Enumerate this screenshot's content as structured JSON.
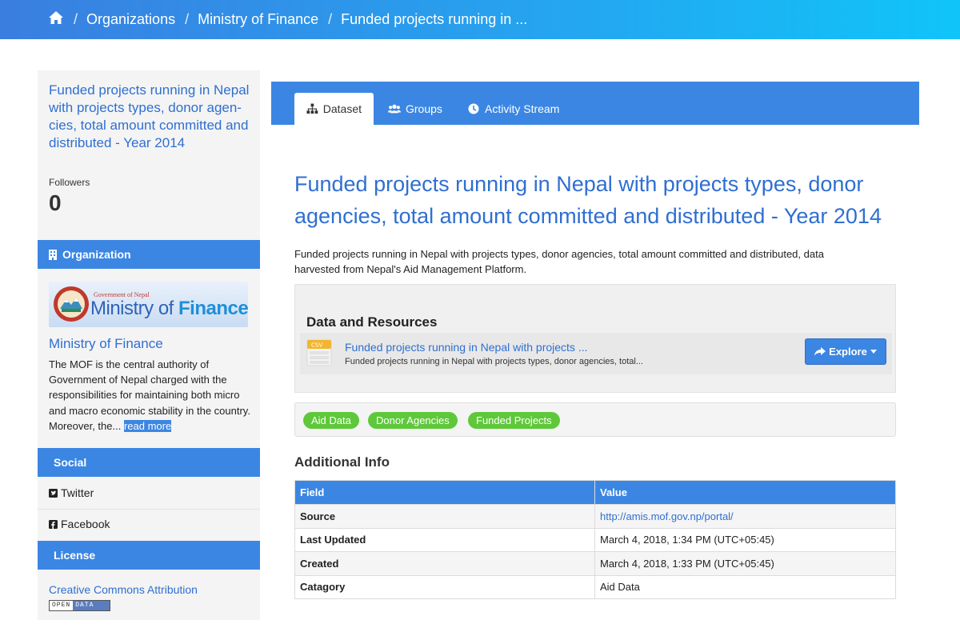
{
  "breadcrumb": {
    "home_icon": "home-icon",
    "separator": "/",
    "items": [
      "Organizations",
      "Ministry of Finance",
      "Funded projects running in ..."
    ]
  },
  "sidebar": {
    "dataset_title": "Funded projects running in Nepal with projects types, donor agen-cies, total amount committed and distributed - Year 2014",
    "followers_label": "Followers",
    "followers_count": "0",
    "organization_heading": "Organization",
    "org_logo": {
      "gov_text": "Government of Nepal",
      "ministry_text": "Ministry of ",
      "finance_text": "Finance"
    },
    "org_name": "Ministry of Finance",
    "org_description": "The MOF is the central authority of Government of Nepal charged with the responsibilities for maintaining both micro and macro economic stability in the country. Moreover, the...",
    "read_more": "read more",
    "social_heading": "Social",
    "social_items": [
      {
        "label": "Twitter",
        "icon": "twitter-icon"
      },
      {
        "label": "Facebook",
        "icon": "facebook-icon"
      }
    ],
    "license_heading": "License",
    "license_name": "Creative Commons Attribution",
    "open_data_badge": {
      "left": "OPEN",
      "right": "DATA"
    }
  },
  "tabs": [
    {
      "label": "Dataset",
      "icon": "sitemap-icon",
      "active": true
    },
    {
      "label": "Groups",
      "icon": "users-icon",
      "active": false
    },
    {
      "label": "Activity Stream",
      "icon": "clock-icon",
      "active": false
    }
  ],
  "main": {
    "title": "Funded projects running in Nepal with projects types, donor agencies, total amount committed and distributed - Year 2014",
    "description": "Funded projects running in Nepal with projects types, donor agencies, total amount committed and distributed, data harvested from Nepal's Aid Management Platform.",
    "resources_heading": "Data and Resources",
    "resource": {
      "format": "CSV",
      "name": "Funded projects running in Nepal with projects ...",
      "description": "Funded projects running in Nepal with projects types, donor agencies, total...",
      "explore_label": "Explore"
    },
    "tags": [
      "Aid Data",
      "Donor Agencies",
      "Funded Projects"
    ],
    "additional_info_heading": "Additional Info",
    "table": {
      "headers": [
        "Field",
        "Value"
      ],
      "rows": [
        {
          "field": "Source",
          "value": "http://amis.mof.gov.np/portal/"
        },
        {
          "field": "Last Updated",
          "value": "March 4, 2018, 1:34 PM (UTC+05:45)"
        },
        {
          "field": "Created",
          "value": "March 4, 2018, 1:33 PM (UTC+05:45)"
        },
        {
          "field": "Catagory",
          "value": "Aid Data"
        }
      ]
    }
  },
  "colors": {
    "primary": "#3b86e3",
    "link": "#2f6fd1",
    "tag": "#5ec83a"
  }
}
